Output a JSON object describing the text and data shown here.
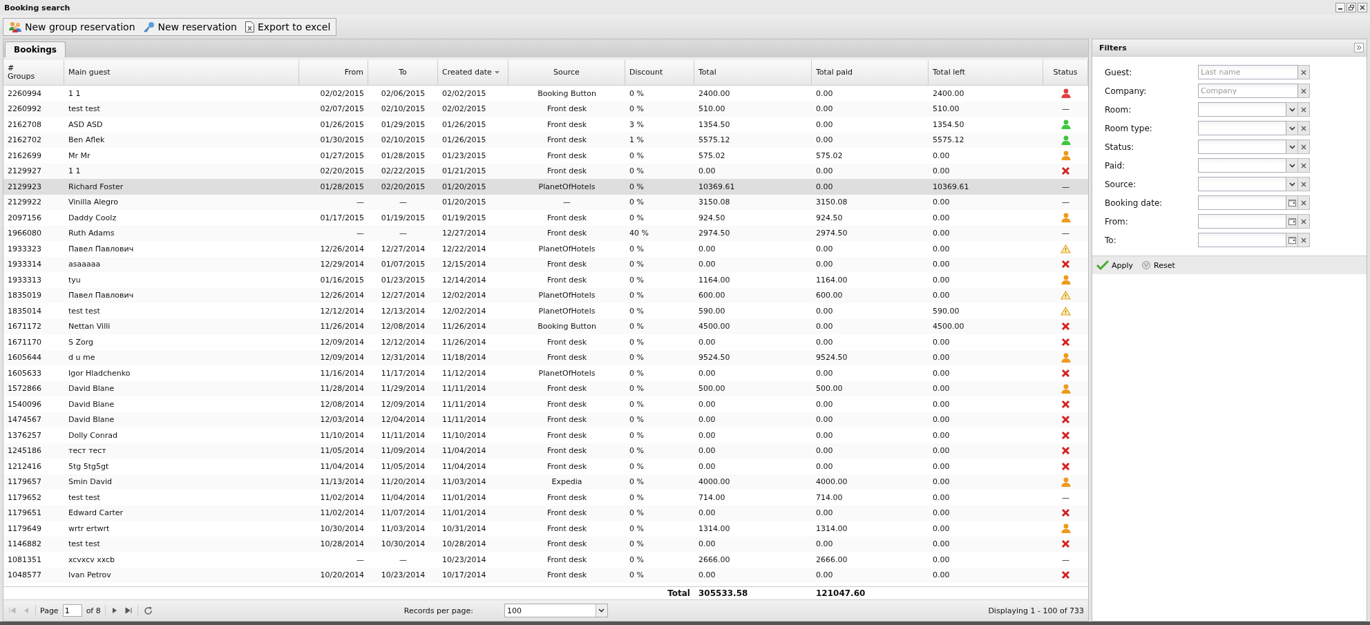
{
  "window": {
    "title": "Booking search"
  },
  "toolbar": [
    {
      "kind": "group",
      "label": "New group reservation"
    },
    {
      "kind": "key",
      "label": "New reservation"
    },
    {
      "kind": "excel",
      "label": "Export to excel"
    }
  ],
  "tabs": [
    {
      "label": "Bookings",
      "selected": true
    }
  ],
  "table": {
    "columns": [
      {
        "label": "#\nGroups",
        "sorted": false
      },
      {
        "label": "Main guest",
        "sorted": false
      },
      {
        "label": "From",
        "sorted": false
      },
      {
        "label": "To",
        "sorted": false
      },
      {
        "label": "Created date",
        "sorted": true
      },
      {
        "label": "Source",
        "sorted": false
      },
      {
        "label": "Discount",
        "sorted": false
      },
      {
        "label": "Total",
        "sorted": false
      },
      {
        "label": "Total paid",
        "sorted": false
      },
      {
        "label": "Total left",
        "sorted": false
      },
      {
        "label": "Status",
        "sorted": false
      }
    ],
    "rows": [
      {
        "selected": false,
        "cells": [
          "2260994",
          "1 1",
          "02/02/2015",
          "02/06/2015",
          "02/02/2015",
          "Booking Button",
          "0 %",
          "2400.00",
          "0.00",
          "2400.00"
        ],
        "status": {
          "kind": "guest",
          "color": "#e04040"
        }
      },
      {
        "selected": false,
        "cells": [
          "2260992",
          "test test",
          "02/07/2015",
          "02/10/2015",
          "02/02/2015",
          "Front desk",
          "0 %",
          "510.00",
          "0.00",
          "510.00"
        ],
        "status": {
          "kind": "text",
          "text": "—"
        }
      },
      {
        "selected": false,
        "cells": [
          "2162708",
          "ASD ASD",
          "01/26/2015",
          "01/29/2015",
          "01/26/2015",
          "Front desk",
          "3 %",
          "1354.50",
          "0.00",
          "1354.50"
        ],
        "status": {
          "kind": "guest",
          "color": "#3cc83c"
        }
      },
      {
        "selected": false,
        "cells": [
          "2162702",
          "Ben Aflek",
          "01/30/2015",
          "02/10/2015",
          "01/26/2015",
          "Front desk",
          "1 %",
          "5575.12",
          "0.00",
          "5575.12"
        ],
        "status": {
          "kind": "guest",
          "color": "#3cc83c"
        }
      },
      {
        "selected": false,
        "cells": [
          "2162699",
          "Mr Mr",
          "01/27/2015",
          "01/28/2015",
          "01/23/2015",
          "Front desk",
          "0 %",
          "575.02",
          "575.02",
          "0.00"
        ],
        "status": {
          "kind": "guest",
          "color": "#ee9a1c"
        }
      },
      {
        "selected": false,
        "cells": [
          "2129927",
          "1 1",
          "02/20/2015",
          "02/22/2015",
          "01/21/2015",
          "Front desk",
          "0 %",
          "0.00",
          "0.00",
          "0.00"
        ],
        "status": {
          "kind": "cancelled"
        }
      },
      {
        "selected": true,
        "cells": [
          "2129923",
          "Richard Foster",
          "01/28/2015",
          "02/20/2015",
          "01/20/2015",
          "PlanetOfHotels",
          "0 %",
          "10369.61",
          "0.00",
          "10369.61"
        ],
        "status": {
          "kind": "text",
          "text": "—"
        }
      },
      {
        "selected": false,
        "cells": [
          "2129922",
          "Vinilla Alegro",
          "—",
          "—",
          "01/20/2015",
          "—",
          "0 %",
          "3150.08",
          "3150.08",
          "0.00"
        ],
        "status": {
          "kind": "text",
          "text": "—"
        }
      },
      {
        "selected": false,
        "cells": [
          "2097156",
          "Daddy Coolz",
          "01/17/2015",
          "01/19/2015",
          "01/19/2015",
          "Front desk",
          "0 %",
          "924.50",
          "924.50",
          "0.00"
        ],
        "status": {
          "kind": "guest",
          "color": "#ee9a1c"
        }
      },
      {
        "selected": false,
        "cells": [
          "1966080",
          "Ruth Adams",
          "—",
          "—",
          "12/27/2014",
          "Front desk",
          "40 %",
          "2974.50",
          "2974.50",
          "0.00"
        ],
        "status": {
          "kind": "text",
          "text": "—"
        }
      },
      {
        "selected": false,
        "cells": [
          "1933323",
          "Павел Павлович",
          "12/26/2014",
          "12/27/2014",
          "12/22/2014",
          "PlanetOfHotels",
          "0 %",
          "0.00",
          "0.00",
          "0.00"
        ],
        "status": {
          "kind": "warning"
        }
      },
      {
        "selected": false,
        "cells": [
          "1933314",
          "asaaaaa",
          "12/29/2014",
          "01/07/2015",
          "12/15/2014",
          "Front desk",
          "0 %",
          "0.00",
          "0.00",
          "0.00"
        ],
        "status": {
          "kind": "cancelled"
        }
      },
      {
        "selected": false,
        "cells": [
          "1933313",
          "tyu",
          "01/16/2015",
          "01/23/2015",
          "12/14/2014",
          "Front desk",
          "0 %",
          "1164.00",
          "1164.00",
          "0.00"
        ],
        "status": {
          "kind": "guest",
          "color": "#ee9a1c"
        }
      },
      {
        "selected": false,
        "cells": [
          "1835019",
          "Павел Павлович",
          "12/26/2014",
          "12/27/2014",
          "12/02/2014",
          "PlanetOfHotels",
          "0 %",
          "600.00",
          "600.00",
          "0.00"
        ],
        "status": {
          "kind": "warning"
        }
      },
      {
        "selected": false,
        "cells": [
          "1835014",
          "test test",
          "12/12/2014",
          "12/13/2014",
          "12/02/2014",
          "PlanetOfHotels",
          "0 %",
          "590.00",
          "0.00",
          "590.00"
        ],
        "status": {
          "kind": "warning"
        }
      },
      {
        "selected": false,
        "cells": [
          "1671172",
          "Nettan Villi",
          "11/26/2014",
          "12/08/2014",
          "11/26/2014",
          "Booking Button",
          "0 %",
          "4500.00",
          "0.00",
          "4500.00"
        ],
        "status": {
          "kind": "cancelled"
        }
      },
      {
        "selected": false,
        "cells": [
          "1671170",
          "S Zorg",
          "12/09/2014",
          "12/12/2014",
          "11/26/2014",
          "Front desk",
          "0 %",
          "0.00",
          "0.00",
          "0.00"
        ],
        "status": {
          "kind": "cancelled"
        }
      },
      {
        "selected": false,
        "cells": [
          "1605644",
          "d u me",
          "12/09/2014",
          "12/31/2014",
          "11/18/2014",
          "Front desk",
          "0 %",
          "9524.50",
          "9524.50",
          "0.00"
        ],
        "status": {
          "kind": "guest",
          "color": "#ee9a1c"
        }
      },
      {
        "selected": false,
        "cells": [
          "1605633",
          "Igor Hladchenko",
          "11/16/2014",
          "11/17/2014",
          "11/12/2014",
          "PlanetOfHotels",
          "0 %",
          "0.00",
          "0.00",
          "0.00"
        ],
        "status": {
          "kind": "cancelled"
        }
      },
      {
        "selected": false,
        "cells": [
          "1572866",
          "David Blane",
          "11/28/2014",
          "11/29/2014",
          "11/11/2014",
          "Front desk",
          "0 %",
          "500.00",
          "500.00",
          "0.00"
        ],
        "status": {
          "kind": "guest",
          "color": "#ee9a1c"
        }
      },
      {
        "selected": false,
        "cells": [
          "1540096",
          "David Blane",
          "12/08/2014",
          "12/09/2014",
          "11/11/2014",
          "Front desk",
          "0 %",
          "0.00",
          "0.00",
          "0.00"
        ],
        "status": {
          "kind": "cancelled"
        }
      },
      {
        "selected": false,
        "cells": [
          "1474567",
          "David Blane",
          "12/03/2014",
          "12/04/2014",
          "11/11/2014",
          "Front desk",
          "0 %",
          "0.00",
          "0.00",
          "0.00"
        ],
        "status": {
          "kind": "cancelled"
        }
      },
      {
        "selected": false,
        "cells": [
          "1376257",
          "Dolly Conrad",
          "11/10/2014",
          "11/11/2014",
          "11/10/2014",
          "Front desk",
          "0 %",
          "0.00",
          "0.00",
          "0.00"
        ],
        "status": {
          "kind": "cancelled"
        }
      },
      {
        "selected": false,
        "cells": [
          "1245186",
          "тест тест",
          "11/05/2014",
          "11/09/2014",
          "11/04/2014",
          "Front desk",
          "0 %",
          "0.00",
          "0.00",
          "0.00"
        ],
        "status": {
          "kind": "cancelled"
        }
      },
      {
        "selected": false,
        "cells": [
          "1212416",
          "5tg 5tg5gt",
          "11/04/2014",
          "11/05/2014",
          "11/04/2014",
          "Front desk",
          "0 %",
          "0.00",
          "0.00",
          "0.00"
        ],
        "status": {
          "kind": "cancelled"
        }
      },
      {
        "selected": false,
        "cells": [
          "1179657",
          "Smin David",
          "11/13/2014",
          "11/20/2014",
          "11/03/2014",
          "Expedia",
          "0 %",
          "4000.00",
          "4000.00",
          "0.00"
        ],
        "status": {
          "kind": "guest",
          "color": "#ee9a1c"
        }
      },
      {
        "selected": false,
        "cells": [
          "1179652",
          "test test",
          "11/02/2014",
          "11/04/2014",
          "11/01/2014",
          "Front desk",
          "0 %",
          "714.00",
          "714.00",
          "0.00"
        ],
        "status": {
          "kind": "text",
          "text": "—"
        }
      },
      {
        "selected": false,
        "cells": [
          "1179651",
          "Edward Carter",
          "11/02/2014",
          "11/07/2014",
          "11/01/2014",
          "Front desk",
          "0 %",
          "0.00",
          "0.00",
          "0.00"
        ],
        "status": {
          "kind": "cancelled"
        }
      },
      {
        "selected": false,
        "cells": [
          "1179649",
          "wrtr ertwrt",
          "10/30/2014",
          "11/03/2014",
          "10/31/2014",
          "Front desk",
          "0 %",
          "1314.00",
          "1314.00",
          "0.00"
        ],
        "status": {
          "kind": "guest",
          "color": "#ee9a1c"
        }
      },
      {
        "selected": false,
        "cells": [
          "1146882",
          "test test",
          "10/28/2014",
          "10/30/2014",
          "10/28/2014",
          "Front desk",
          "0 %",
          "0.00",
          "0.00",
          "0.00"
        ],
        "status": {
          "kind": "cancelled"
        }
      },
      {
        "selected": false,
        "cells": [
          "1081351",
          "xcvxcv xxcb",
          "—",
          "—",
          "10/23/2014",
          "Front desk",
          "0 %",
          "2666.00",
          "2666.00",
          "0.00"
        ],
        "status": {
          "kind": "text",
          "text": "—"
        }
      },
      {
        "selected": false,
        "cells": [
          "1048577",
          "Ivan Petrov",
          "10/20/2014",
          "10/23/2014",
          "10/17/2014",
          "Front desk",
          "0 %",
          "0.00",
          "0.00",
          "0.00"
        ],
        "status": {
          "kind": "cancelled"
        }
      }
    ],
    "totals": {
      "label": "Total",
      "total": "305533.58",
      "total_paid": "121047.60"
    }
  },
  "pager": {
    "page_label": "Page",
    "page": "1",
    "of_label": "of 8",
    "records_label": "Records per page:",
    "records": "100",
    "displaying": "Displaying 1 - 100 of 733"
  },
  "filters": {
    "title": "Filters",
    "fields": [
      {
        "label": "Guest:",
        "kind": "text",
        "placeholder": "Last name"
      },
      {
        "label": "Company:",
        "kind": "text",
        "placeholder": "Company"
      },
      {
        "label": "Room:",
        "kind": "select"
      },
      {
        "label": "Room type:",
        "kind": "select"
      },
      {
        "label": "Status:",
        "kind": "select"
      },
      {
        "label": "Paid:",
        "kind": "select"
      },
      {
        "label": "Source:",
        "kind": "select"
      },
      {
        "label": "Booking date:",
        "kind": "date"
      },
      {
        "label": "From:",
        "kind": "date"
      },
      {
        "label": "To:",
        "kind": "date"
      }
    ],
    "apply": "Apply",
    "reset": "Reset"
  }
}
